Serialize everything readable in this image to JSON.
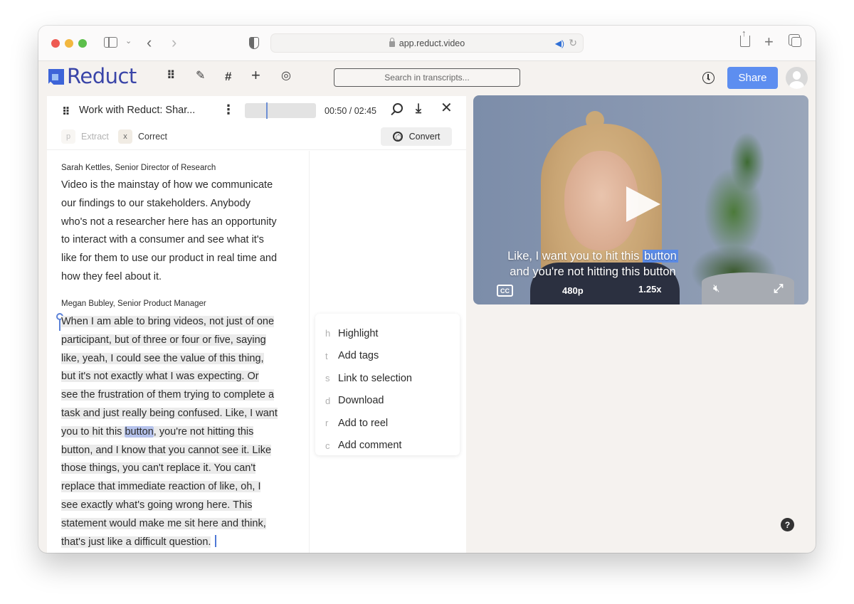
{
  "browser": {
    "url": "app.reduct.video",
    "icons": [
      "sidebar-icon",
      "chevron-down-icon",
      "back-icon",
      "forward-icon",
      "privacy-shield-icon",
      "lock-icon",
      "speaker-icon",
      "reload-icon",
      "share-icon",
      "new-tab-icon",
      "tabs-overview-icon"
    ]
  },
  "header": {
    "logo_text": "Reduct",
    "nav_icons": [
      {
        "name": "people-icon",
        "glyph": "⠿"
      },
      {
        "name": "highlighter-icon",
        "glyph": "✎"
      },
      {
        "name": "hashtag-icon",
        "glyph": "#"
      },
      {
        "name": "plus-icon",
        "glyph": "+"
      },
      {
        "name": "reel-icon",
        "glyph": "◎"
      }
    ],
    "search_placeholder": "Search in transcripts...",
    "share_label": "Share",
    "accent_color": "#5d8ef0"
  },
  "toolbar": {
    "project_title": "Work with Reduct:  Shar...",
    "timecode": "00:50 / 02:45",
    "timeline_progress": 0.303,
    "modes": [
      {
        "key": "p",
        "label": "Extract",
        "active": false
      },
      {
        "key": "x",
        "label": "Correct",
        "active": true
      }
    ],
    "convert_label": "Convert"
  },
  "transcript": {
    "blocks": [
      {
        "speaker": "Sarah Kettles, Senior Director of Research",
        "lines": [
          "Video is the mainstay of how we communicate",
          "our findings to our stakeholders. Anybody",
          "who's not a researcher here has an opportunity",
          "to interact with a consumer and see what it's",
          "like for them to use our product in real time and",
          "how they feel about it."
        ]
      },
      {
        "speaker": "Megan Bubley, Senior Product Manager",
        "lines": [
          "When I am able to bring videos, not just of one",
          "participant, but of three or four or five, saying",
          "like, yeah, I could see the value of this thing,",
          "but it's not exactly what I was expecting. Or",
          "see the frustration of them trying to complete a",
          "task and just really being confused. Like, I want",
          "you to hit this ",
          "button, and I know that you cannot see it. Like",
          "those things, you can't replace it. You can't",
          "replace that immediate reaction of like, oh, I",
          "see exactly what's going wrong here. This",
          "statement would make me sit here and think,",
          "that's just like a difficult question."
        ],
        "highlighted_word": "button",
        "after_highlight": ", you're not hitting this"
      }
    ]
  },
  "context_menu": {
    "items": [
      {
        "key": "h",
        "label": "Highlight"
      },
      {
        "key": "t",
        "label": "Add tags"
      },
      {
        "key": "s",
        "label": "Link to selection"
      },
      {
        "key": "d",
        "label": "Download"
      },
      {
        "key": "r",
        "label": "Add to reel"
      },
      {
        "key": "c",
        "label": "Add comment"
      }
    ]
  },
  "video": {
    "caption_line1_pre": "Like, I want you to hit this ",
    "caption_line1_hl": "button",
    "caption_line2": "and you're not hitting this button",
    "cc_label": "CC",
    "quality": "480p",
    "speed": "1.25x"
  },
  "help_label": "?"
}
